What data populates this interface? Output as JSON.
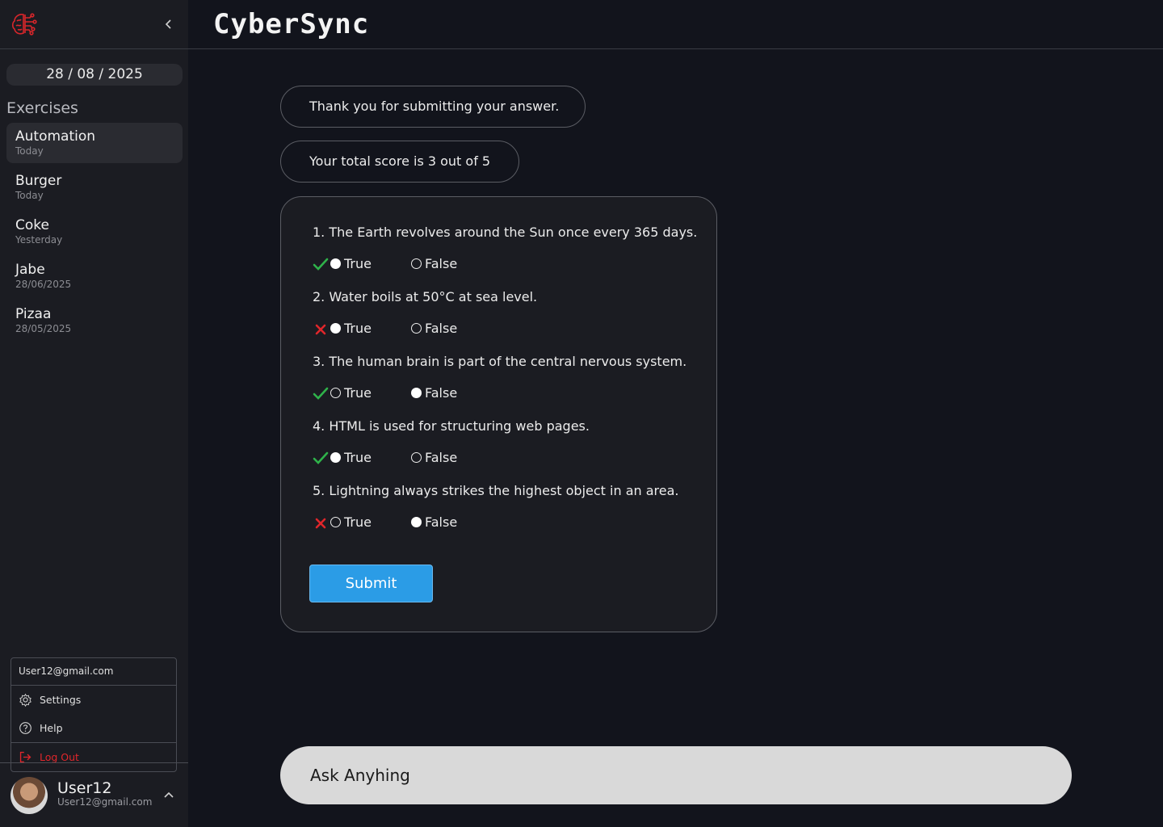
{
  "brand": {
    "name": "CyberSync"
  },
  "sidebar": {
    "date": "28 / 08 / 2025",
    "section_title": "Exercises",
    "items": [
      {
        "name": "Automation",
        "date": "Today",
        "active": true
      },
      {
        "name": "Burger",
        "date": "Today",
        "active": false
      },
      {
        "name": "Coke",
        "date": "Yesterday",
        "active": false
      },
      {
        "name": "Jabe",
        "date": "28/06/2025",
        "active": false
      },
      {
        "name": "Pizaa",
        "date": "28/05/2025",
        "active": false
      }
    ]
  },
  "user_menu": {
    "email": "User12@gmail.com",
    "settings_label": "Settings",
    "help_label": "Help",
    "logout_label": "Log Out"
  },
  "user": {
    "name": "User12",
    "email": "User12@gmail.com"
  },
  "chat": {
    "thanks_message": "Thank you for submitting your answer.",
    "score_message": "Your total score is 3 out of 5"
  },
  "quiz": {
    "questions": [
      {
        "text": "1. The Earth revolves around the Sun once every 365 days.",
        "selected": "True",
        "correct": true
      },
      {
        "text": "2. Water boils at 50°C at sea level.",
        "selected": "True",
        "correct": false
      },
      {
        "text": "3. The human brain is part of the central nervous system.",
        "selected": "False",
        "correct": true
      },
      {
        "text": "4. HTML is used for structuring web pages.",
        "selected": "True",
        "correct": true
      },
      {
        "text": "5. Lightning always strikes the highest object in an area.",
        "selected": "False",
        "correct": false
      }
    ],
    "true_label": "True",
    "false_label": "False",
    "submit_label": "Submit"
  },
  "ask": {
    "placeholder": "Ask Anyhing"
  },
  "colors": {
    "correct": "#2fb24a",
    "wrong": "#e0262b",
    "accent": "#2b9ce6",
    "logo": "#d8262b"
  }
}
